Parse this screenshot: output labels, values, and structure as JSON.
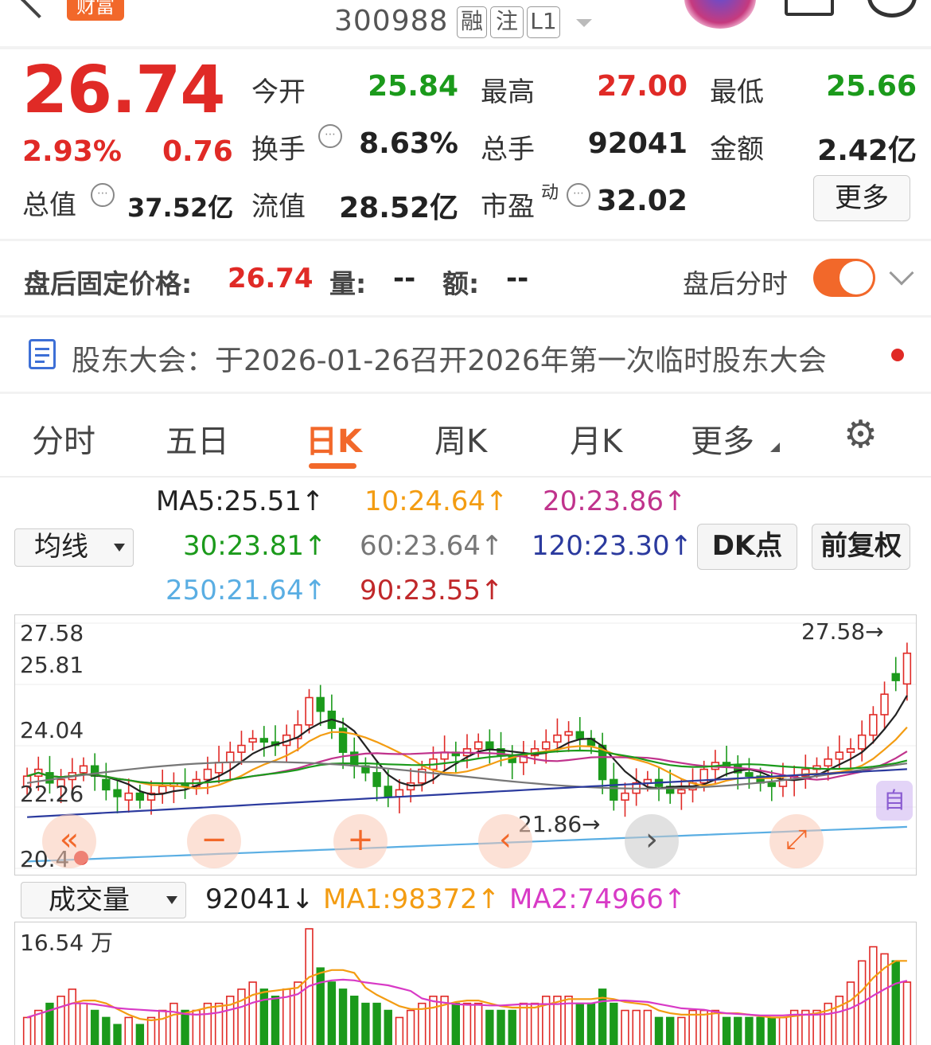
{
  "header": {
    "brand": "财富",
    "code": "300988",
    "badges": [
      "融",
      "注",
      "L1"
    ]
  },
  "quote": {
    "price": "26.74",
    "change_pct": "2.93%",
    "change": "0.76",
    "open_label": "今开",
    "open": "25.84",
    "high_label": "最高",
    "high": "27.00",
    "low_label": "最低",
    "low": "25.66",
    "turnover_label": "换手",
    "turnover": "8.63%",
    "volume_label": "总手",
    "volume": "92041",
    "amount_label": "金额",
    "amount": "2.42亿",
    "mktcap_label": "总值",
    "mktcap": "37.52亿",
    "float_label": "流值",
    "float": "28.52亿",
    "pe_label": "市盈",
    "pe_sup": "动",
    "pe": "32.02",
    "more": "更多"
  },
  "after_hours": {
    "label": "盘后固定价格:",
    "price": "26.74",
    "vol_label": "量:",
    "vol": "--",
    "amt_label": "额:",
    "amt": "--",
    "toggle_label": "盘后分时",
    "toggle_on": true
  },
  "notice": "股东大会：于2026-01-26召开2026年第一次临时股东大会",
  "tabs": [
    "分时",
    "五日",
    "日K",
    "周K",
    "月K",
    "更多"
  ],
  "active_tab": "日K",
  "ma": {
    "selector": "均线",
    "items": [
      {
        "text": "MA5:25.51↑",
        "color": "#222222"
      },
      {
        "text": "10:24.64↑",
        "color": "#f39c12"
      },
      {
        "text": "20:23.86↑",
        "color": "#c0338c"
      },
      {
        "text": "30:23.81↑",
        "color": "#1b9a1b"
      },
      {
        "text": "60:23.64↑",
        "color": "#777777"
      },
      {
        "text": "120:23.30↑",
        "color": "#2b3a9e"
      },
      {
        "text": "250:21.64↑",
        "color": "#5aaee3"
      },
      {
        "text": "90:23.55↑",
        "color": "#c0282a"
      }
    ],
    "dk_button": "DK点",
    "adjust_button": "前复权"
  },
  "kline": {
    "y_labels": [
      "27.58",
      "25.81",
      "24.04",
      "22.26",
      "20.4"
    ],
    "max_marker": "27.58→",
    "min_marker": "21.86→",
    "auto_label": "自"
  },
  "volume": {
    "selector": "成交量",
    "current": "92041↓",
    "ma1": "MA1:98372↑",
    "ma2": "MA2:74966↑",
    "y_max": "16.54 万"
  },
  "chart_data": {
    "type": "candlestick",
    "series": [
      {
        "name": "MA5",
        "color": "#222222"
      },
      {
        "name": "MA10",
        "color": "#f39c12"
      },
      {
        "name": "MA20",
        "color": "#c0338c"
      },
      {
        "name": "MA30",
        "color": "#1b9a1b"
      },
      {
        "name": "MA60",
        "color": "#777777"
      },
      {
        "name": "MA120",
        "color": "#2b3a9e"
      },
      {
        "name": "MA250",
        "color": "#5aaee3"
      }
    ],
    "ylim": [
      20.4,
      27.58
    ],
    "closes": [
      23.1,
      23.3,
      22.9,
      23.0,
      23.2,
      23.4,
      23.1,
      22.7,
      22.5,
      22.6,
      22.4,
      22.6,
      22.8,
      22.9,
      22.8,
      23.0,
      23.3,
      23.5,
      23.8,
      24.0,
      24.2,
      24.1,
      24.0,
      24.3,
      24.6,
      25.4,
      25.0,
      24.5,
      23.8,
      23.4,
      23.2,
      22.8,
      22.5,
      22.7,
      22.9,
      23.3,
      23.6,
      23.8,
      23.7,
      23.9,
      24.1,
      23.9,
      23.7,
      23.5,
      23.7,
      23.9,
      24.1,
      24.3,
      24.4,
      24.2,
      24.0,
      23.0,
      22.4,
      22.6,
      22.9,
      23.0,
      22.8,
      22.6,
      22.7,
      22.9,
      23.3,
      23.5,
      23.4,
      23.2,
      23.1,
      22.9,
      22.8,
      23.0,
      23.1,
      23.3,
      23.4,
      23.6,
      23.8,
      23.9,
      24.3,
      24.9,
      25.5,
      25.9,
      26.7
    ],
    "opens": [
      22.8,
      23.1,
      23.2,
      22.8,
      23.0,
      23.2,
      23.4,
      23.0,
      22.7,
      22.4,
      22.6,
      22.4,
      22.6,
      22.8,
      22.9,
      22.8,
      23.0,
      23.2,
      23.5,
      23.8,
      24.1,
      24.2,
      24.1,
      24.0,
      24.2,
      24.6,
      25.4,
      25.0,
      24.5,
      23.8,
      23.4,
      23.2,
      22.8,
      22.5,
      22.7,
      22.9,
      23.3,
      23.6,
      23.8,
      23.7,
      23.9,
      24.1,
      23.9,
      23.7,
      23.5,
      23.7,
      23.9,
      24.1,
      24.3,
      24.4,
      24.2,
      24.0,
      23.0,
      22.4,
      22.6,
      22.9,
      23.0,
      22.8,
      22.6,
      22.7,
      22.9,
      23.3,
      23.5,
      23.4,
      23.2,
      23.1,
      22.9,
      22.8,
      23.0,
      23.1,
      23.3,
      23.4,
      23.6,
      23.8,
      23.9,
      24.3,
      24.9,
      26.1,
      25.8
    ],
    "volumes": [
      4,
      5,
      6,
      7,
      8,
      6,
      5,
      4,
      3,
      4,
      3,
      4,
      5,
      6,
      5,
      5,
      6,
      6,
      7,
      8,
      9,
      8,
      7,
      8,
      9,
      16.54,
      11,
      9,
      8,
      7,
      6,
      6,
      5,
      4,
      5,
      6,
      7,
      7,
      6,
      6,
      6,
      5,
      5,
      5,
      6,
      6,
      7,
      7,
      7,
      6,
      6,
      8,
      6,
      5,
      5,
      5,
      4,
      4,
      4,
      5,
      5,
      5,
      4,
      4,
      4,
      4,
      4,
      4,
      5,
      5,
      5,
      6,
      7,
      9,
      12,
      14,
      13,
      12,
      9
    ]
  }
}
